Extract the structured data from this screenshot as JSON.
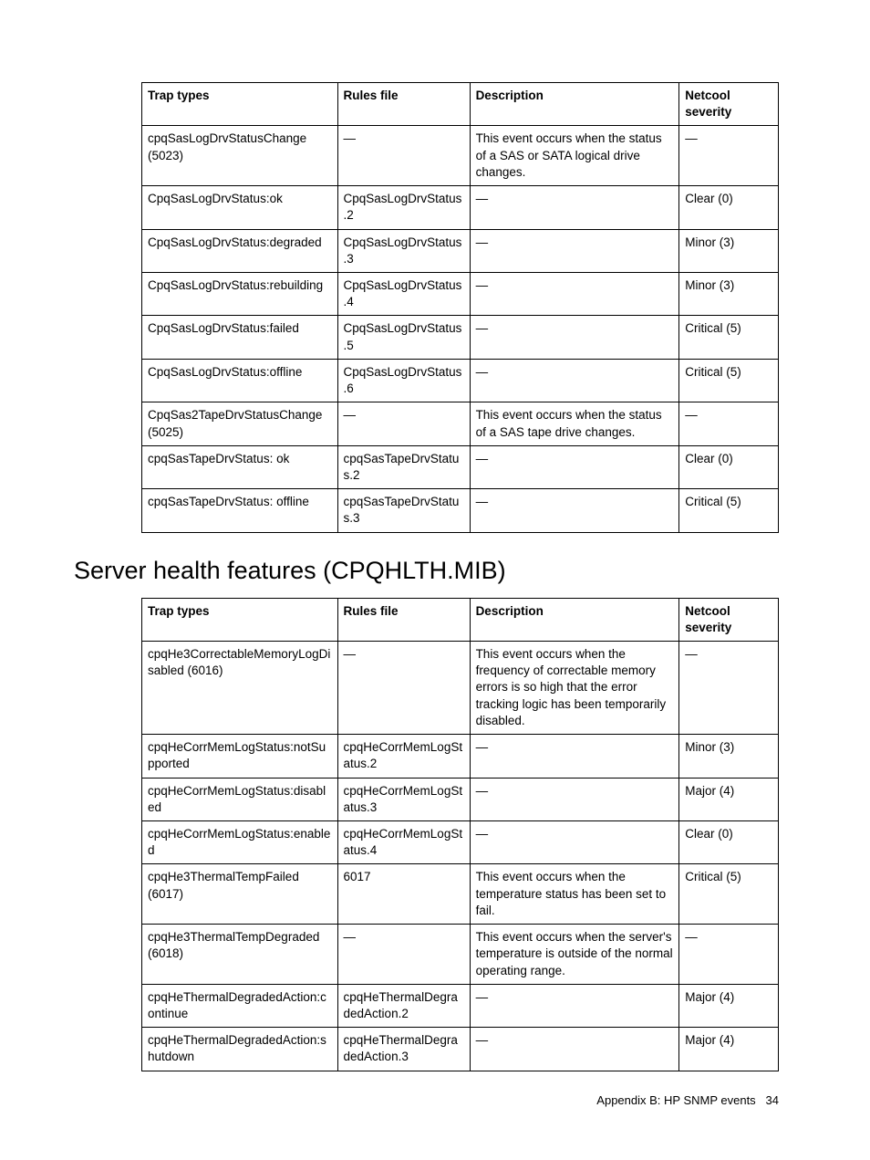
{
  "table1": {
    "headers": [
      "Trap types",
      "Rules file",
      "Description",
      "Netcool severity"
    ],
    "rows": [
      [
        "cpqSasLogDrvStatusChange (5023)",
        "—",
        "This event occurs when the status of a SAS or SATA logical drive changes.",
        "—"
      ],
      [
        "CpqSasLogDrvStatus:ok",
        "CpqSasLogDrvStatus.2",
        "—",
        "Clear (0)"
      ],
      [
        "CpqSasLogDrvStatus:degraded",
        "CpqSasLogDrvStatus.3",
        "—",
        "Minor (3)"
      ],
      [
        "CpqSasLogDrvStatus:rebuilding",
        "CpqSasLogDrvStatus.4",
        "—",
        "Minor (3)"
      ],
      [
        "CpqSasLogDrvStatus:failed",
        "CpqSasLogDrvStatus.5",
        "—",
        "Critical (5)"
      ],
      [
        "CpqSasLogDrvStatus:offline",
        "CpqSasLogDrvStatus.6",
        "—",
        "Critical (5)"
      ],
      [
        "CpqSas2TapeDrvStatusChange (5025)",
        "—",
        "This event occurs when the status of a SAS tape drive changes.",
        "—"
      ],
      [
        "cpqSasTapeDrvStatus: ok",
        "cpqSasTapeDrvStatus.2",
        "—",
        "Clear (0)"
      ],
      [
        "cpqSasTapeDrvStatus: offline",
        "cpqSasTapeDrvStatus.3",
        "—",
        "Critical (5)"
      ]
    ]
  },
  "heading2": "Server health features (CPQHLTH.MIB)",
  "table2": {
    "headers": [
      "Trap types",
      "Rules file",
      "Description",
      "Netcool severity"
    ],
    "rows": [
      [
        "cpqHe3CorrectableMemoryLogDisabled (6016)",
        "—",
        "This event occurs when the frequency of correctable memory errors is so high that the error tracking logic has been temporarily disabled.",
        "—"
      ],
      [
        "cpqHeCorrMemLogStatus:notSupported",
        "cpqHeCorrMemLogStatus.2",
        "—",
        "Minor (3)"
      ],
      [
        "cpqHeCorrMemLogStatus:disabled",
        "cpqHeCorrMemLogStatus.3",
        "—",
        "Major (4)"
      ],
      [
        "cpqHeCorrMemLogStatus:enabled",
        "cpqHeCorrMemLogStatus.4",
        "—",
        "Clear (0)"
      ],
      [
        "cpqHe3ThermalTempFailed (6017)",
        "6017",
        "This event occurs when the temperature status has been set to fail.",
        "Critical (5)"
      ],
      [
        "cpqHe3ThermalTempDegraded (6018)",
        "—",
        "This event occurs when the server's temperature is outside of the normal operating range.",
        "—"
      ],
      [
        "cpqHeThermalDegradedAction:continue",
        "cpqHeThermalDegradedAction.2",
        "—",
        "Major (4)"
      ],
      [
        "cpqHeThermalDegradedAction:shutdown",
        "cpqHeThermalDegradedAction.3",
        "—",
        "Major (4)"
      ]
    ]
  },
  "footer": {
    "text": "Appendix B: HP SNMP events",
    "page": "34"
  }
}
